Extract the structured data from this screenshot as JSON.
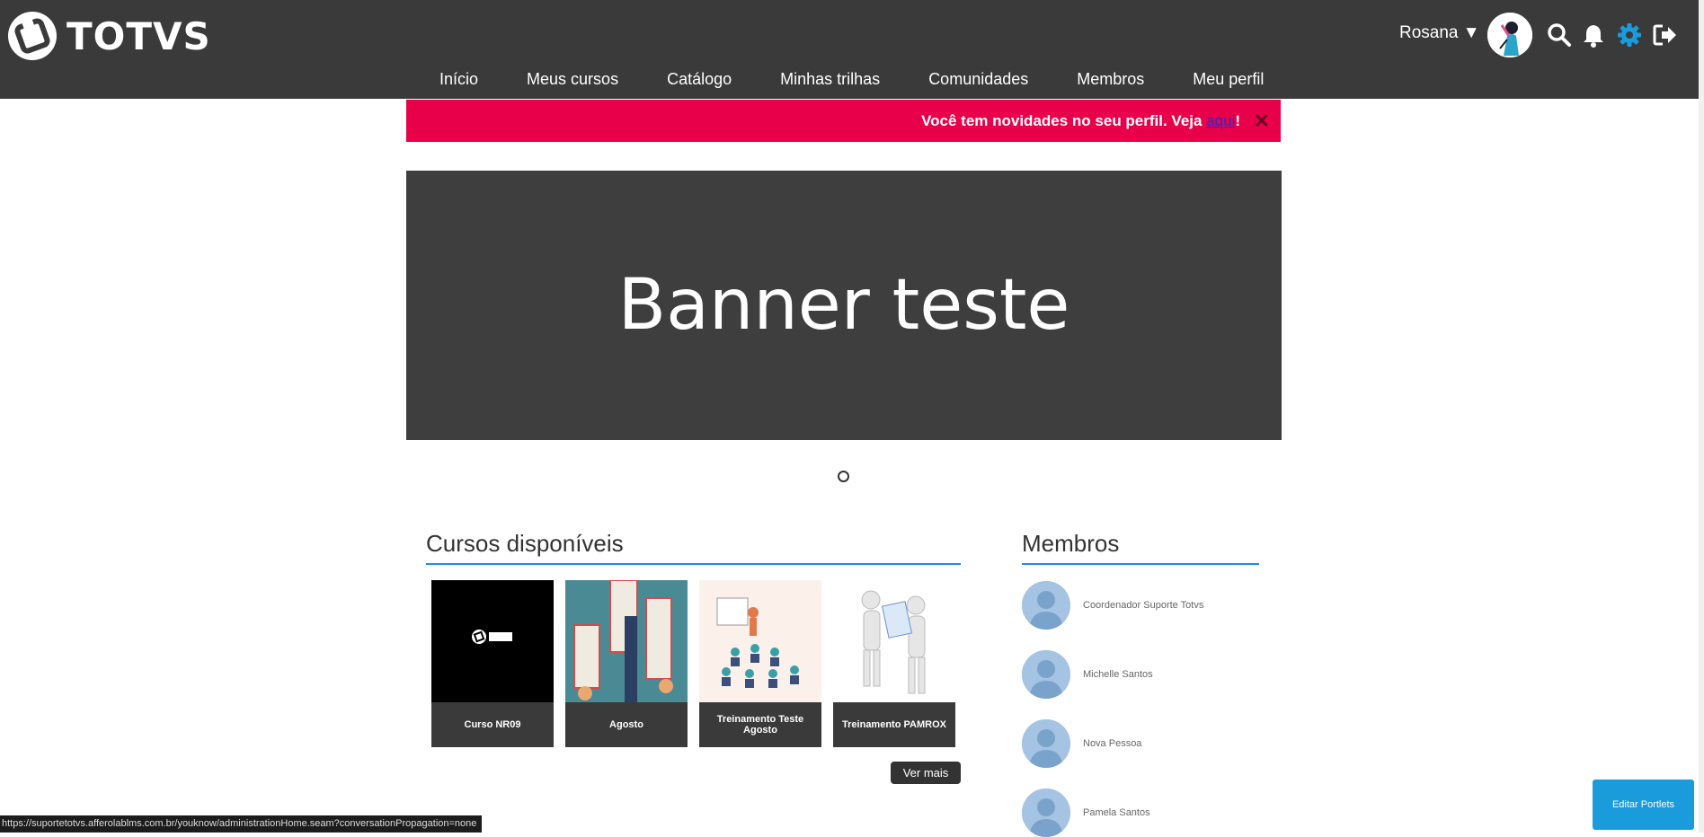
{
  "header": {
    "brand": "TOTVS",
    "user_name": "Rosana",
    "user_caret": "▼",
    "icons": [
      "search-icon",
      "bell-icon",
      "gear-icon",
      "logout-icon"
    ],
    "nav": [
      {
        "label": "Início"
      },
      {
        "label": "Meus cursos"
      },
      {
        "label": "Catálogo"
      },
      {
        "label": "Minhas trilhas"
      },
      {
        "label": "Comunidades"
      },
      {
        "label": "Membros"
      },
      {
        "label": "Meu perfil"
      }
    ]
  },
  "notice": {
    "text": "Você tem novidades no seu perfil. Veja ",
    "link": "aqui",
    "suffix": "!",
    "close": "✕",
    "color": "#e8004a"
  },
  "banner": {
    "title": "Banner teste"
  },
  "courses": {
    "title": "Cursos disponíveis",
    "items": [
      {
        "label": "Curso NR09"
      },
      {
        "label": "Agosto"
      },
      {
        "label": "Treinamento Teste Agosto"
      },
      {
        "label": "Treinamento PAMROX"
      }
    ],
    "more": "Ver mais"
  },
  "members": {
    "title": "Membros",
    "items": [
      {
        "name": "Coordenador Suporte Totvs"
      },
      {
        "name": "Michelle Santos"
      },
      {
        "name": "Nova Pessoa"
      },
      {
        "name": "Pamela Santos"
      }
    ]
  },
  "status_url": "https://suportetotvs.afferolablms.com.br/youknow/administrationHome.seam?conversationPropagation=none",
  "edit_portlets": "Editar Portlets",
  "colors": {
    "accent": "#1e8fd8",
    "topbar": "#3a3a3a",
    "gear": "#1a9bdb"
  }
}
